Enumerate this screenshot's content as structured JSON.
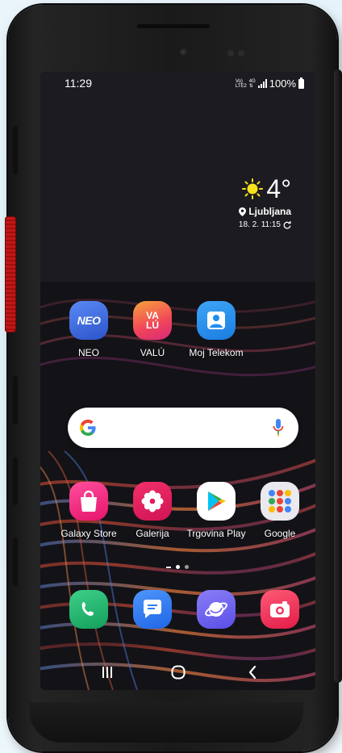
{
  "status_bar": {
    "time": "11:29",
    "volte_top": "Vo)",
    "volte_bottom": "LTE2",
    "network": "4G",
    "battery": "100%"
  },
  "weather": {
    "temperature": "4°",
    "location": "Ljubljana",
    "updated": "18. 2. 11:15",
    "icon": "sun-icon",
    "sun_color": "#f7e21b"
  },
  "apps_row1": [
    {
      "label": "NEO",
      "icon": "neo-icon",
      "icon_text": "NEO",
      "color": "#3b6fe0"
    },
    {
      "label": "VALÚ",
      "icon": "valu-icon",
      "icon_text_top": "VA",
      "icon_text_bottom": "LÚ",
      "color": "#f0445a"
    },
    {
      "label": "Moj Telekom",
      "icon": "user-icon",
      "color": "#1e8ef0"
    }
  ],
  "search": {
    "logo": "G",
    "icon": "microphone-icon"
  },
  "apps_row2": [
    {
      "label": "Galaxy Store",
      "icon": "shopping-bag-icon",
      "color": "#f2217a"
    },
    {
      "label": "Galerija",
      "icon": "flower-icon",
      "color": "#e51d5d"
    },
    {
      "label": "Trgovina Play",
      "icon": "play-triangle-icon",
      "color": "#ffffff"
    },
    {
      "label": "Google",
      "icon": "google-folder-icon",
      "color": "#f1f1f1"
    }
  ],
  "dock": [
    {
      "name": "phone",
      "icon": "phone-icon",
      "color": "#1fb16b"
    },
    {
      "name": "messages",
      "icon": "message-icon",
      "color": "#2f7ef5"
    },
    {
      "name": "internet",
      "icon": "planet-icon",
      "color": "#6e63f0"
    },
    {
      "name": "camera",
      "icon": "camera-icon",
      "color": "#f0325a"
    }
  ],
  "nav": {
    "recents": "recents-icon",
    "home": "home-icon",
    "back": "back-icon"
  }
}
